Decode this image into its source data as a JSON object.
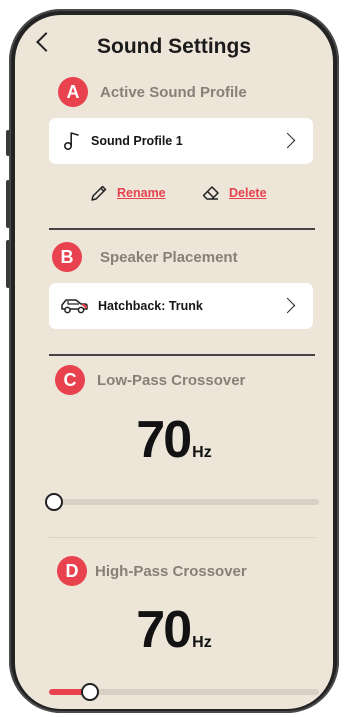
{
  "header": {
    "title": "Sound Settings"
  },
  "sections": {
    "a": {
      "badge": "A",
      "label": "Active Sound Profile",
      "card_value": "Sound Profile 1",
      "rename": "Rename",
      "delete": "Delete"
    },
    "b": {
      "badge": "B",
      "label": "Speaker Placement",
      "card_value": "Hatchback: Trunk"
    },
    "c": {
      "badge": "C",
      "label": "Low-Pass Crossover",
      "value": "70",
      "unit": "Hz",
      "slider_fraction": 0.02
    },
    "d": {
      "badge": "D",
      "label": "High-Pass Crossover",
      "value": "70",
      "unit": "Hz",
      "slider_fraction": 0.15
    }
  },
  "colors": {
    "accent": "#e8424e",
    "background": "#ece5d8",
    "card": "#ffffff",
    "label_gray": "#8a7f78"
  }
}
